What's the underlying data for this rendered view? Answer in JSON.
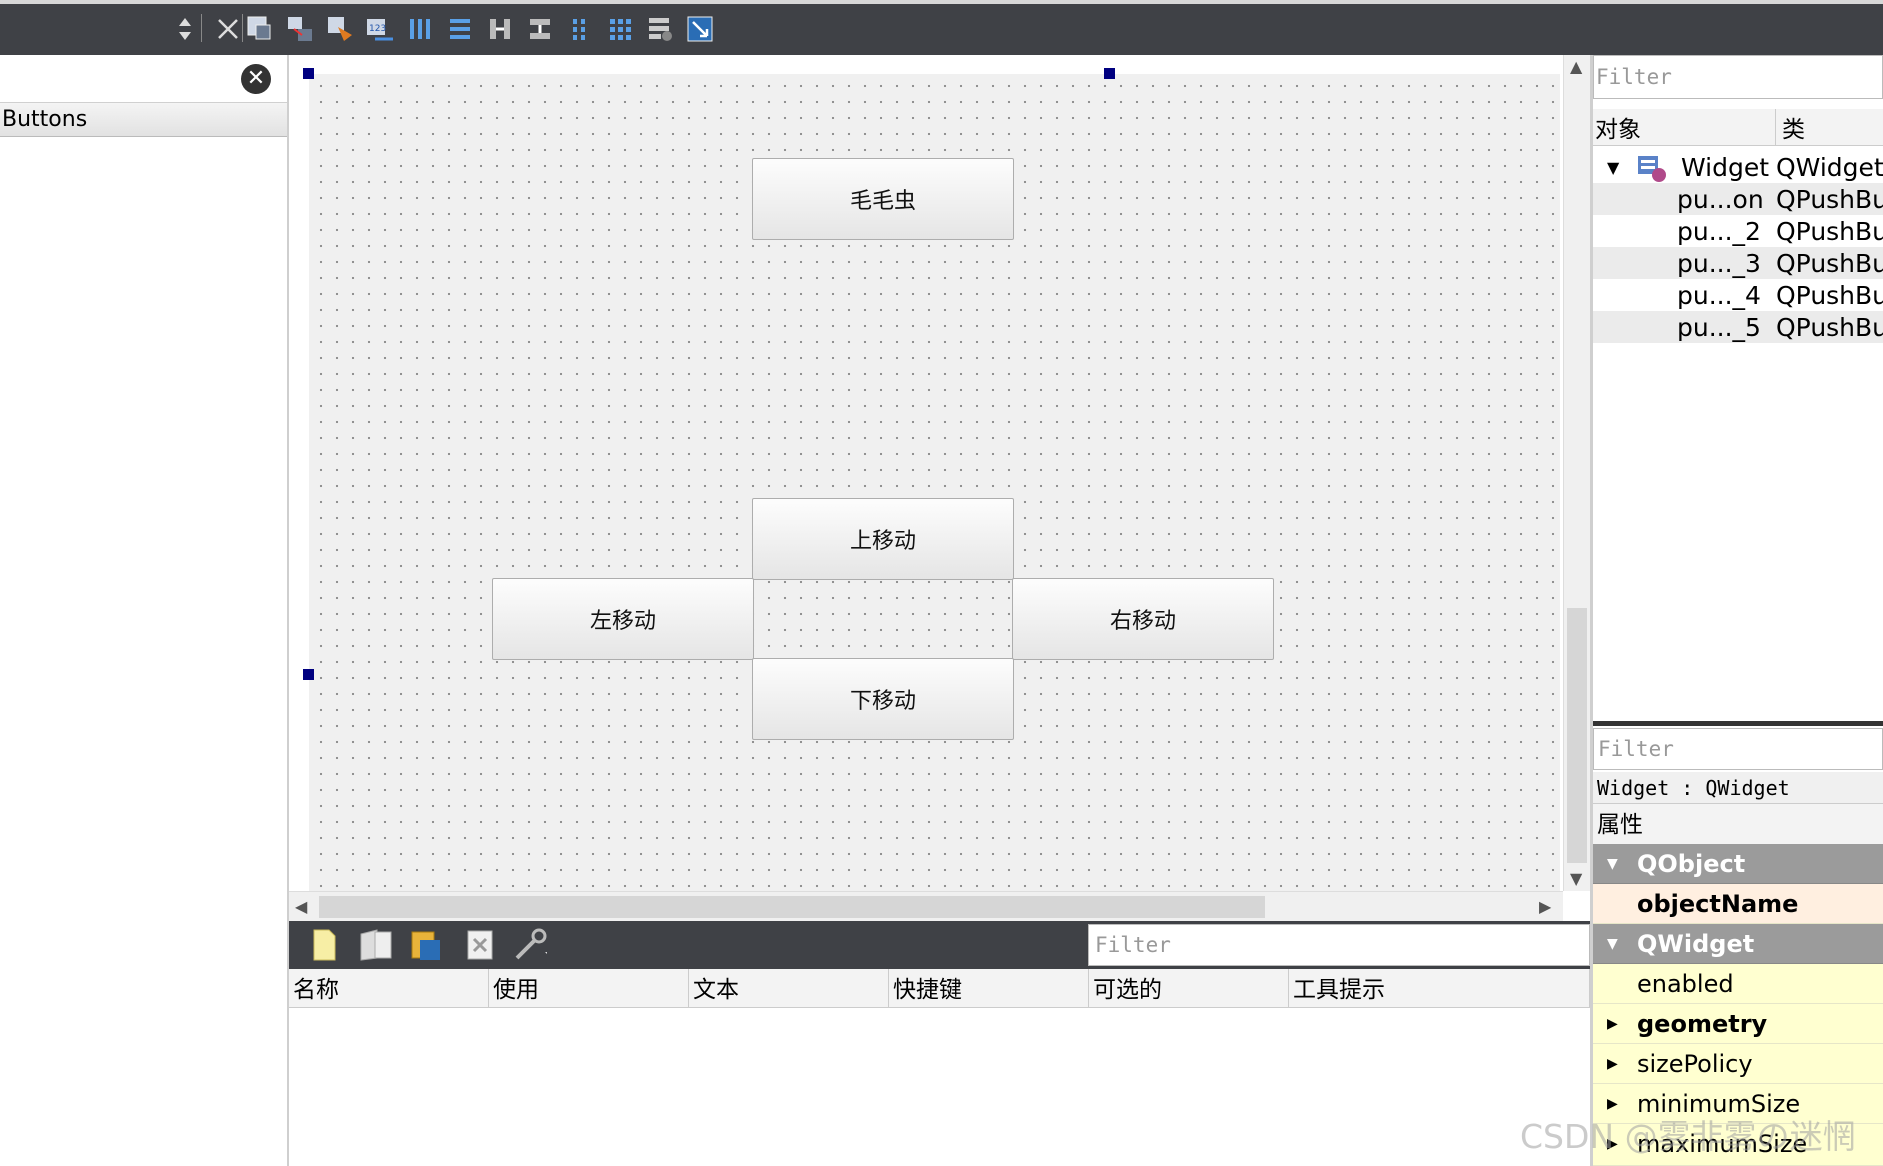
{
  "widget_box": {
    "category": "Buttons"
  },
  "form_buttons": {
    "caterpillar": "毛毛虫",
    "up": "上移动",
    "left": "左移动",
    "right": "右移动",
    "down": "下移动"
  },
  "action_editor": {
    "filter_placeholder": "Filter",
    "columns": [
      "名称",
      "使用",
      "文本",
      "快捷键",
      "可选的",
      "工具提示"
    ]
  },
  "object_inspector": {
    "filter_placeholder": "Filter",
    "col_object": "对象",
    "col_class": "类",
    "root": {
      "name": "Widget",
      "class": "QWidget"
    },
    "children": [
      {
        "name": "pu...on",
        "class": "QPushButton"
      },
      {
        "name": "pu..._2",
        "class": "QPushButton"
      },
      {
        "name": "pu..._3",
        "class": "QPushButton"
      },
      {
        "name": "pu..._4",
        "class": "QPushButton"
      },
      {
        "name": "pu..._5",
        "class": "QPushButton"
      }
    ]
  },
  "property_editor": {
    "filter_placeholder": "Filter",
    "object_label": "Widget : QWidget",
    "header": "属性",
    "rows": [
      {
        "label": "QObject",
        "type": "group"
      },
      {
        "label": "objectName",
        "type": "bold"
      },
      {
        "label": "QWidget",
        "type": "group"
      },
      {
        "label": "enabled",
        "type": "normal"
      },
      {
        "label": "geometry",
        "type": "bold-expand"
      },
      {
        "label": "sizePolicy",
        "type": "expand"
      },
      {
        "label": "minimumSize",
        "type": "expand"
      },
      {
        "label": "maximumSize",
        "type": "expand"
      }
    ]
  },
  "watermark": "CSDN @雾非雾の迷惘",
  "colors": {
    "toolbar_bg": "#3f4146",
    "form_bg": "#f0f0f0",
    "handle": "#000080",
    "group_bg": "#9b9b9b",
    "prop_row_yellow": "#ffffd0",
    "prop_row_orange": "#ffefe0"
  },
  "toolbar_icons": [
    "sort-icon",
    "close-icon",
    "edit-widgets-icon",
    "edit-signals-icon",
    "edit-buddies-icon",
    "edit-tab-order-icon",
    "layout-horizontal-icon",
    "layout-vertical-icon",
    "splitter-horizontal-icon",
    "splitter-vertical-icon",
    "layout-form-icon",
    "layout-grid-icon",
    "break-layout-icon",
    "adjust-size-icon"
  ]
}
